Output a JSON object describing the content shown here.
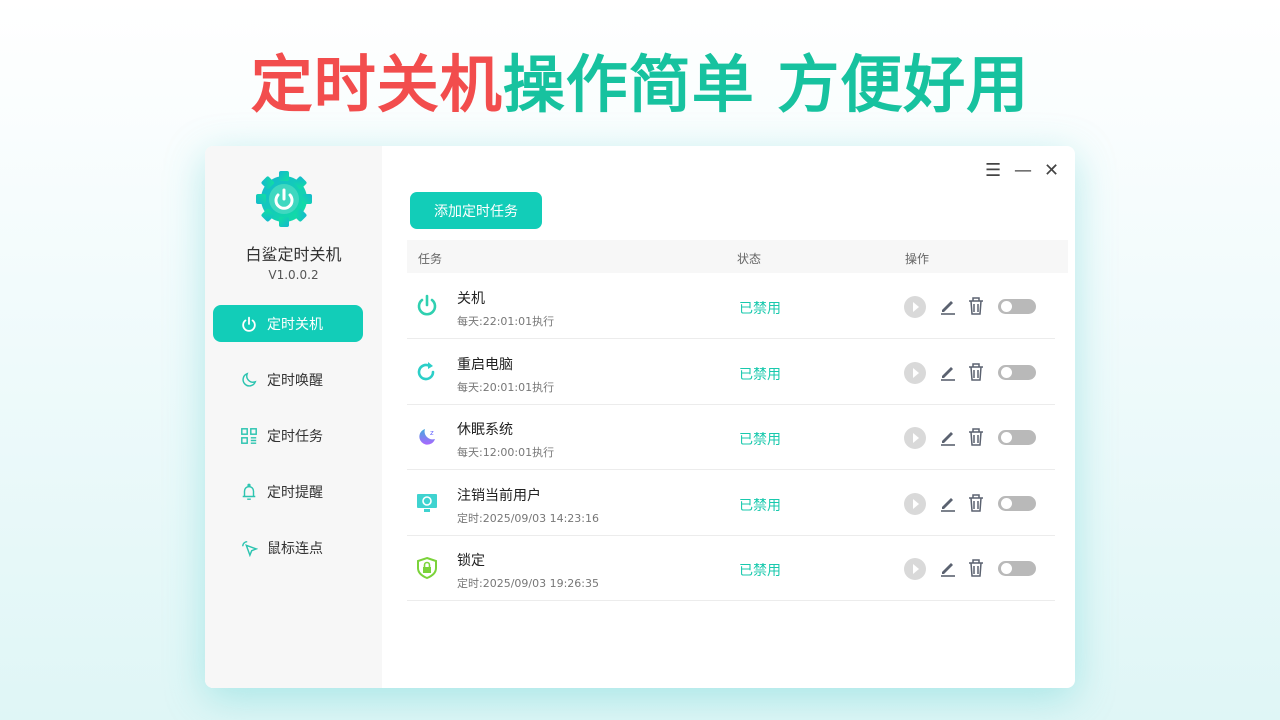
{
  "headline": {
    "part1": "定时关机",
    "part2": "操作简单 方便好用"
  },
  "app": {
    "name": "白鲨定时关机",
    "version": "V1.0.0.2"
  },
  "sidebar": {
    "items": [
      {
        "label": "定时关机",
        "icon": "power-icon",
        "active": true
      },
      {
        "label": "定时唤醒",
        "icon": "moon-icon"
      },
      {
        "label": "定时任务",
        "icon": "grid-list-icon"
      },
      {
        "label": "定时提醒",
        "icon": "bell-icon"
      },
      {
        "label": "鼠标连点",
        "icon": "cursor-click-icon"
      }
    ]
  },
  "toolbar": {
    "add_label": "添加定时任务"
  },
  "table": {
    "headers": [
      "任务",
      "状态",
      "操作"
    ],
    "rows": [
      {
        "name": "关机",
        "schedule": "每天:22:01:01执行",
        "status": "已禁用",
        "icon": "power-icon",
        "enabled": false
      },
      {
        "name": "重启电脑",
        "schedule": "每天:20:01:01执行",
        "status": "已禁用",
        "icon": "restart-icon",
        "enabled": false
      },
      {
        "name": "休眠系统",
        "schedule": "每天:12:00:01执行",
        "status": "已禁用",
        "icon": "sleep-moon-icon",
        "enabled": false
      },
      {
        "name": "注销当前用户",
        "schedule": "定时:2025/09/03 14:23:16",
        "status": "已禁用",
        "icon": "logout-monitor-icon",
        "enabled": false
      },
      {
        "name": "锁定",
        "schedule": "定时:2025/09/03 19:26:35",
        "status": "已禁用",
        "icon": "lock-shield-icon",
        "enabled": false
      }
    ]
  },
  "colors": {
    "accent": "#12cdb8",
    "headline_red": "#f24d4d",
    "headline_green": "#17c29f"
  }
}
